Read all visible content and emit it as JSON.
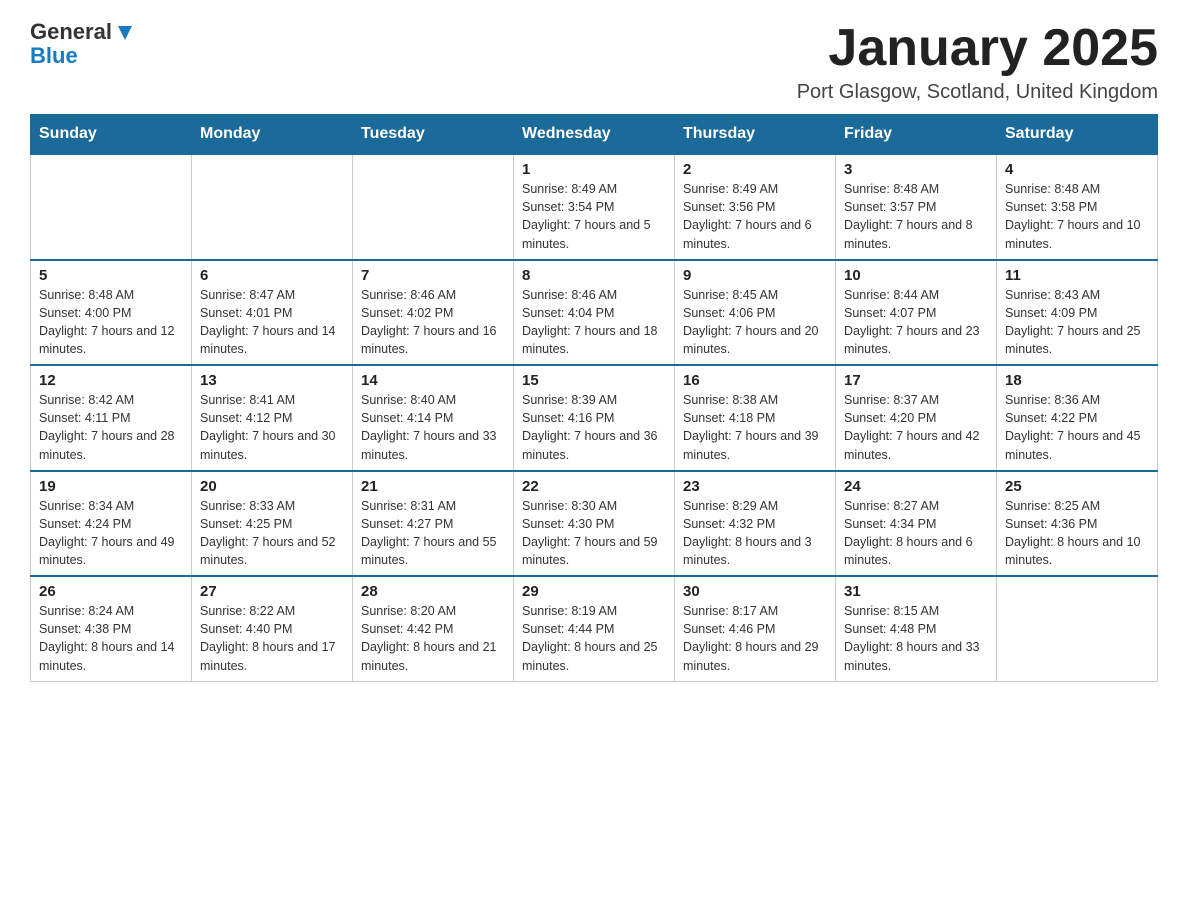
{
  "header": {
    "logo_text_general": "General",
    "logo_text_blue": "Blue",
    "title": "January 2025",
    "subtitle": "Port Glasgow, Scotland, United Kingdom"
  },
  "days_of_week": [
    "Sunday",
    "Monday",
    "Tuesday",
    "Wednesday",
    "Thursday",
    "Friday",
    "Saturday"
  ],
  "weeks": [
    [
      {
        "day": "",
        "info": ""
      },
      {
        "day": "",
        "info": ""
      },
      {
        "day": "",
        "info": ""
      },
      {
        "day": "1",
        "info": "Sunrise: 8:49 AM\nSunset: 3:54 PM\nDaylight: 7 hours and 5 minutes."
      },
      {
        "day": "2",
        "info": "Sunrise: 8:49 AM\nSunset: 3:56 PM\nDaylight: 7 hours and 6 minutes."
      },
      {
        "day": "3",
        "info": "Sunrise: 8:48 AM\nSunset: 3:57 PM\nDaylight: 7 hours and 8 minutes."
      },
      {
        "day": "4",
        "info": "Sunrise: 8:48 AM\nSunset: 3:58 PM\nDaylight: 7 hours and 10 minutes."
      }
    ],
    [
      {
        "day": "5",
        "info": "Sunrise: 8:48 AM\nSunset: 4:00 PM\nDaylight: 7 hours and 12 minutes."
      },
      {
        "day": "6",
        "info": "Sunrise: 8:47 AM\nSunset: 4:01 PM\nDaylight: 7 hours and 14 minutes."
      },
      {
        "day": "7",
        "info": "Sunrise: 8:46 AM\nSunset: 4:02 PM\nDaylight: 7 hours and 16 minutes."
      },
      {
        "day": "8",
        "info": "Sunrise: 8:46 AM\nSunset: 4:04 PM\nDaylight: 7 hours and 18 minutes."
      },
      {
        "day": "9",
        "info": "Sunrise: 8:45 AM\nSunset: 4:06 PM\nDaylight: 7 hours and 20 minutes."
      },
      {
        "day": "10",
        "info": "Sunrise: 8:44 AM\nSunset: 4:07 PM\nDaylight: 7 hours and 23 minutes."
      },
      {
        "day": "11",
        "info": "Sunrise: 8:43 AM\nSunset: 4:09 PM\nDaylight: 7 hours and 25 minutes."
      }
    ],
    [
      {
        "day": "12",
        "info": "Sunrise: 8:42 AM\nSunset: 4:11 PM\nDaylight: 7 hours and 28 minutes."
      },
      {
        "day": "13",
        "info": "Sunrise: 8:41 AM\nSunset: 4:12 PM\nDaylight: 7 hours and 30 minutes."
      },
      {
        "day": "14",
        "info": "Sunrise: 8:40 AM\nSunset: 4:14 PM\nDaylight: 7 hours and 33 minutes."
      },
      {
        "day": "15",
        "info": "Sunrise: 8:39 AM\nSunset: 4:16 PM\nDaylight: 7 hours and 36 minutes."
      },
      {
        "day": "16",
        "info": "Sunrise: 8:38 AM\nSunset: 4:18 PM\nDaylight: 7 hours and 39 minutes."
      },
      {
        "day": "17",
        "info": "Sunrise: 8:37 AM\nSunset: 4:20 PM\nDaylight: 7 hours and 42 minutes."
      },
      {
        "day": "18",
        "info": "Sunrise: 8:36 AM\nSunset: 4:22 PM\nDaylight: 7 hours and 45 minutes."
      }
    ],
    [
      {
        "day": "19",
        "info": "Sunrise: 8:34 AM\nSunset: 4:24 PM\nDaylight: 7 hours and 49 minutes."
      },
      {
        "day": "20",
        "info": "Sunrise: 8:33 AM\nSunset: 4:25 PM\nDaylight: 7 hours and 52 minutes."
      },
      {
        "day": "21",
        "info": "Sunrise: 8:31 AM\nSunset: 4:27 PM\nDaylight: 7 hours and 55 minutes."
      },
      {
        "day": "22",
        "info": "Sunrise: 8:30 AM\nSunset: 4:30 PM\nDaylight: 7 hours and 59 minutes."
      },
      {
        "day": "23",
        "info": "Sunrise: 8:29 AM\nSunset: 4:32 PM\nDaylight: 8 hours and 3 minutes."
      },
      {
        "day": "24",
        "info": "Sunrise: 8:27 AM\nSunset: 4:34 PM\nDaylight: 8 hours and 6 minutes."
      },
      {
        "day": "25",
        "info": "Sunrise: 8:25 AM\nSunset: 4:36 PM\nDaylight: 8 hours and 10 minutes."
      }
    ],
    [
      {
        "day": "26",
        "info": "Sunrise: 8:24 AM\nSunset: 4:38 PM\nDaylight: 8 hours and 14 minutes."
      },
      {
        "day": "27",
        "info": "Sunrise: 8:22 AM\nSunset: 4:40 PM\nDaylight: 8 hours and 17 minutes."
      },
      {
        "day": "28",
        "info": "Sunrise: 8:20 AM\nSunset: 4:42 PM\nDaylight: 8 hours and 21 minutes."
      },
      {
        "day": "29",
        "info": "Sunrise: 8:19 AM\nSunset: 4:44 PM\nDaylight: 8 hours and 25 minutes."
      },
      {
        "day": "30",
        "info": "Sunrise: 8:17 AM\nSunset: 4:46 PM\nDaylight: 8 hours and 29 minutes."
      },
      {
        "day": "31",
        "info": "Sunrise: 8:15 AM\nSunset: 4:48 PM\nDaylight: 8 hours and 33 minutes."
      },
      {
        "day": "",
        "info": ""
      }
    ]
  ]
}
